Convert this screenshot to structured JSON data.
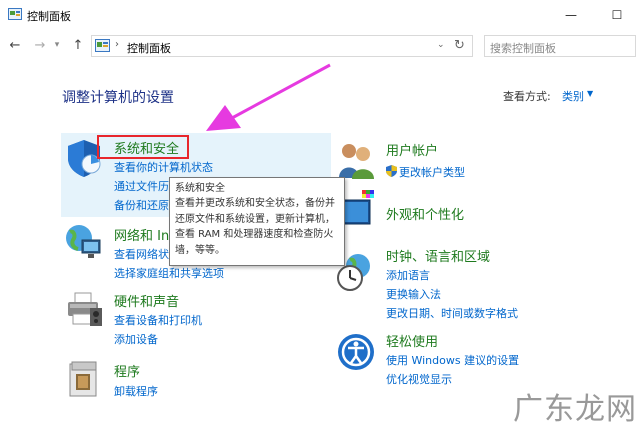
{
  "window": {
    "title": "控制面板",
    "minimize_label": "—",
    "maximize_label": "☐"
  },
  "navbar": {
    "back_label": "←",
    "forward_label": "→",
    "dropdown_label": "▾",
    "up_label": "↑",
    "address_separator": "›",
    "address_crumb": "控制面板",
    "address_dropdown": "⌄",
    "refresh_label": "↻",
    "search_placeholder": "搜索控制面板"
  },
  "main": {
    "heading": "调整计算机的设置",
    "view_by_label": "查看方式:",
    "view_by_value": "类别",
    "view_by_caret": "▼"
  },
  "categories": [
    {
      "title": "系统和安全",
      "icon": "shield-icon",
      "links": [
        "查看你的计算机状态",
        "通过文件历",
        "备份和还原"
      ]
    },
    {
      "title": "网络和 In",
      "icon": "network-globe-icon",
      "links": [
        "查看网络状",
        "选择家庭组和共享选项"
      ]
    },
    {
      "title": "硬件和声音",
      "icon": "printer-icon",
      "links": [
        "查看设备和打印机",
        "添加设备"
      ]
    },
    {
      "title": "程序",
      "icon": "programs-icon",
      "links": [
        "卸载程序"
      ]
    },
    {
      "title": "用户帐户",
      "icon": "users-icon",
      "links": [
        "更改帐户类型"
      ]
    },
    {
      "title": "外观和个性化",
      "icon": "appearance-icon",
      "links": []
    },
    {
      "title": "时钟、语言和区域",
      "icon": "clock-globe-icon",
      "links": [
        "添加语言",
        "更换输入法",
        "更改日期、时间或数字格式"
      ]
    },
    {
      "title": "轻松使用",
      "icon": "ease-of-access-icon",
      "links": [
        "使用 Windows 建议的设置",
        "优化视觉显示"
      ]
    }
  ],
  "tooltip": {
    "title": "系统和安全",
    "lines": [
      "查看并更改系统和安全状态，备份并",
      "还原文件和系统设置，更新计算机，",
      "查看 RAM 和处理器速度和检查防火",
      "墙，等等。"
    ]
  },
  "annotation": {
    "arrow_color": "#e63ae0",
    "box_color": "#e8262c"
  },
  "watermark": "广东龙网",
  "colors": {
    "heading": "#1e3287",
    "category_title": "#1e7a1e",
    "link": "#0066cc",
    "highlight": "#e5f3fb"
  }
}
